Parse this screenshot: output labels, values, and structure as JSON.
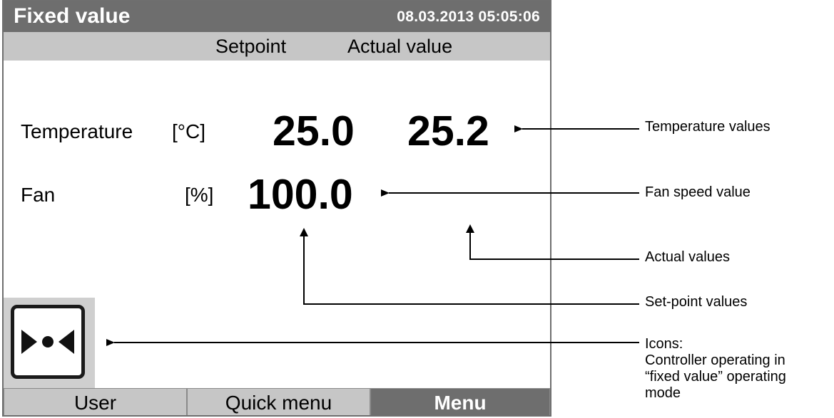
{
  "screen": {
    "title": "Fixed value",
    "datetime": "08.03.2013  05:05:06",
    "columns": {
      "setpoint": "Setpoint",
      "actual": "Actual value"
    },
    "rows": {
      "temperature": {
        "label": "Temperature",
        "unit": "[°C]",
        "setpoint": "25.0",
        "actual": "25.2"
      },
      "fan": {
        "label": "Fan",
        "unit": "[%]",
        "setpoint": "100.0"
      }
    },
    "mode_icon": "fixed-value-mode-icon",
    "softkeys": {
      "user": "User",
      "quick_menu": "Quick menu",
      "menu": "Menu"
    }
  },
  "annotations": {
    "temperature_values": "Temperature values",
    "fan_speed_value": "Fan speed value",
    "actual_values": "Actual values",
    "setpoint_values": "Set-point values",
    "icons_title": "Icons:",
    "icons_line1": "Controller operating in",
    "icons_line2": "“fixed value” operating",
    "icons_line3": "mode"
  },
  "colors": {
    "title_bar": "#6e6e6e",
    "header_bar": "#c6c6c6",
    "softkey": "#c6c6c6",
    "softkey_active": "#6e6e6e"
  }
}
